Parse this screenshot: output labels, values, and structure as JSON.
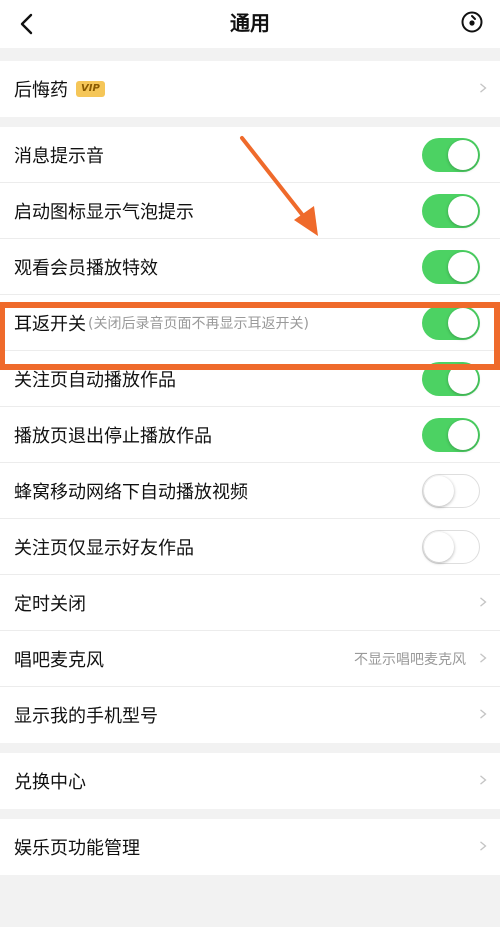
{
  "header": {
    "title": "通用",
    "back_icon": "chevron-left-icon",
    "more_icon": "circle-dot-icon"
  },
  "groups": {
    "g1": {
      "regret": {
        "label": "后悔药",
        "badge": "VIP"
      }
    },
    "g2": {
      "message_sound": {
        "label": "消息提示音",
        "enabled": true
      },
      "badge_bubble": {
        "label": "启动图标显示气泡提示",
        "enabled": true
      },
      "member_effect": {
        "label": "观看会员播放特效",
        "enabled": true
      },
      "ear_return": {
        "label": "耳返开关",
        "hint": "(关闭后录音页面不再显示耳返开关)",
        "enabled": true
      },
      "follow_autoplay": {
        "label": "关注页自动播放作品",
        "enabled": true
      },
      "stop_on_exit": {
        "label": "播放页退出停止播放作品",
        "enabled": true
      },
      "cellular_autoplay": {
        "label": "蜂窝移动网络下自动播放视频",
        "enabled": false
      },
      "friends_only": {
        "label": "关注页仅显示好友作品",
        "enabled": false
      },
      "timer_off": {
        "label": "定时关闭"
      },
      "mic": {
        "label": "唱吧麦克风",
        "value": "不显示唱吧麦克风"
      },
      "show_model": {
        "label": "显示我的手机型号"
      }
    },
    "g3": {
      "redeem": {
        "label": "兑换中心"
      }
    },
    "g4": {
      "entertainment": {
        "label": "娱乐页功能管理"
      }
    }
  },
  "colors": {
    "toggle_on": "#4cd263",
    "annotation": "#ef6a2b",
    "vip_badge": "#f5c658"
  }
}
